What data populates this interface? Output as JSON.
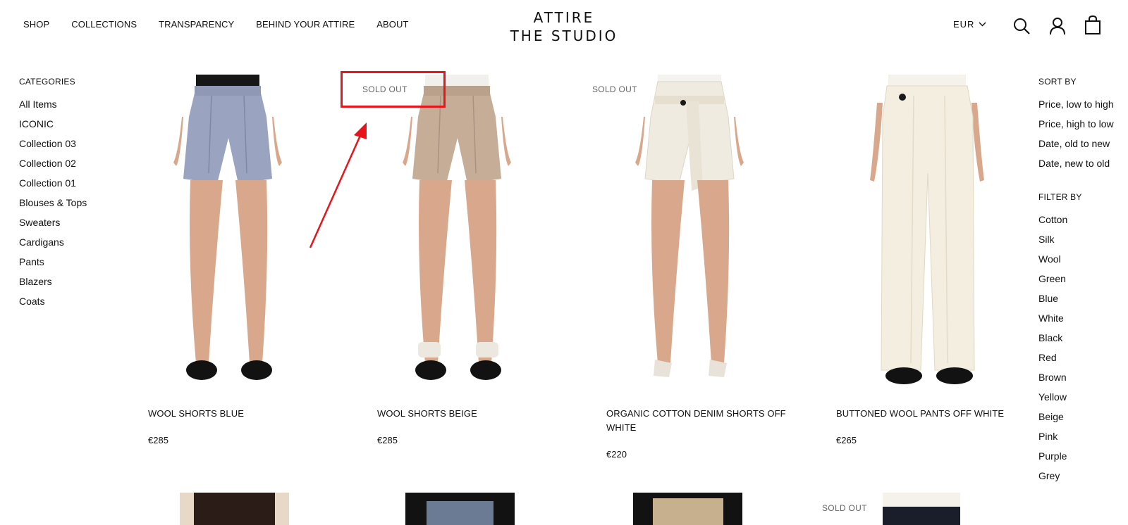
{
  "nav": [
    "SHOP",
    "COLLECTIONS",
    "TRANSPARENCY",
    "BEHIND YOUR ATTIRE",
    "ABOUT"
  ],
  "logo": {
    "line1": "ATTIRE",
    "line2": "THE STUDIO"
  },
  "currency": "EUR",
  "categories": {
    "title": "CATEGORIES",
    "items": [
      "All Items",
      "ICONIC",
      "Collection 03",
      "Collection 02",
      "Collection 01",
      "Blouses & Tops",
      "Sweaters",
      "Cardigans",
      "Pants",
      "Blazers",
      "Coats"
    ]
  },
  "sort": {
    "title": "SORT BY",
    "items": [
      "Price, low to high",
      "Price, high to low",
      "Date, old to new",
      "Date, new to old"
    ]
  },
  "filter": {
    "title": "FILTER BY",
    "items": [
      "Cotton",
      "Silk",
      "Wool",
      "Green",
      "Blue",
      "White",
      "Black",
      "Red",
      "Brown",
      "Yellow",
      "Beige",
      "Pink",
      "Purple",
      "Grey"
    ]
  },
  "products": [
    {
      "name": "WOOL SHORTS BLUE",
      "price": "€285",
      "badge": "",
      "garment": "#9aa3bf"
    },
    {
      "name": "WOOL SHORTS BEIGE",
      "price": "€285",
      "badge": "SOLD OUT",
      "garment": "#c5ad98"
    },
    {
      "name": "ORGANIC COTTON DENIM SHORTS OFF WHITE",
      "price": "€220",
      "badge": "SOLD OUT",
      "garment": "#f0ebe0"
    },
    {
      "name": "BUTTONED WOOL PANTS OFF WHITE",
      "price": "€265",
      "badge": "",
      "garment": "#f3eee0"
    }
  ],
  "second_row_badge": "SOLD OUT",
  "colors": {
    "annotation": "#e8141c",
    "skin": "#d9a88c"
  }
}
